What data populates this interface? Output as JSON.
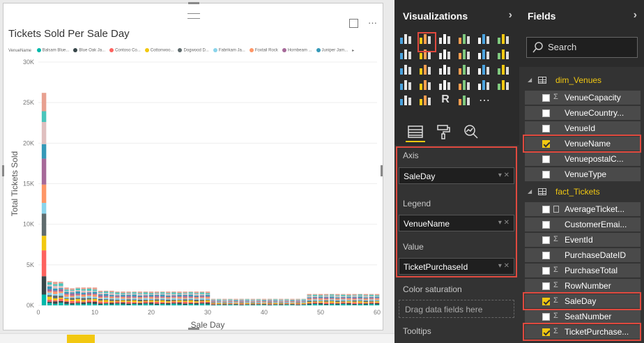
{
  "visual": {
    "title": "Tickets Sold Per Sale Day",
    "legend_title": "VenueName",
    "legend_items": [
      {
        "label": "Balsam Blue...",
        "color": "#01b8aa"
      },
      {
        "label": "Blue Oak Ja...",
        "color": "#374649"
      },
      {
        "label": "Contoso Co...",
        "color": "#fd625e"
      },
      {
        "label": "Cottonwoo...",
        "color": "#f2c80f"
      },
      {
        "label": "Dogwood D...",
        "color": "#5f6b6d"
      },
      {
        "label": "Fabrikam Ja...",
        "color": "#8ad4eb"
      },
      {
        "label": "Foxtail Rock",
        "color": "#fe9666"
      },
      {
        "label": "Hornbeam ...",
        "color": "#a66999"
      },
      {
        "label": "Juniper Jam...",
        "color": "#3599b8"
      }
    ],
    "focus_icon": "expand-icon",
    "more_icon": "ellipsis-icon"
  },
  "chart_data": {
    "type": "bar",
    "stacked": true,
    "xlabel": "Sale Day",
    "ylabel": "Total Tickets Sold",
    "xlim": [
      0,
      60
    ],
    "ylim": [
      0,
      30000
    ],
    "x_ticks": [
      "0",
      "10",
      "20",
      "30",
      "40",
      "50",
      "60"
    ],
    "y_ticks": [
      "0K",
      "5K",
      "10K",
      "15K",
      "20K",
      "25K",
      "30K"
    ],
    "grid": true,
    "legend_position": "top",
    "x": [
      1,
      2,
      3,
      4,
      5,
      6,
      7,
      8,
      9,
      10,
      11,
      12,
      13,
      14,
      15,
      16,
      17,
      18,
      19,
      20,
      21,
      22,
      23,
      24,
      25,
      26,
      27,
      28,
      29,
      30,
      31,
      32,
      33,
      34,
      35,
      36,
      37,
      38,
      39,
      40,
      41,
      42,
      43,
      44,
      45,
      46,
      47,
      48,
      49,
      50,
      51,
      52,
      53,
      54,
      55,
      56,
      57,
      58,
      59,
      60
    ],
    "totals": [
      26200,
      3000,
      2900,
      2900,
      2200,
      2100,
      2200,
      2200,
      2200,
      2200,
      1800,
      1800,
      1800,
      1700,
      1700,
      1700,
      1700,
      1700,
      1700,
      1700,
      1700,
      1700,
      1700,
      1700,
      1700,
      1700,
      1700,
      1700,
      1700,
      1700,
      800,
      800,
      800,
      800,
      800,
      800,
      800,
      800,
      800,
      800,
      800,
      800,
      800,
      800,
      800,
      800,
      800,
      1400,
      1400,
      1400,
      1400,
      1400,
      1400,
      1400,
      1400,
      1400,
      1400,
      1400,
      1400,
      1400
    ],
    "series_colors": [
      "#01b8aa",
      "#374649",
      "#fd625e",
      "#f2c80f",
      "#5f6b6d",
      "#8ad4eb",
      "#fe9666",
      "#a66999",
      "#3599b8",
      "#dfbfbf",
      "#4ac5bb",
      "#e8a090"
    ]
  },
  "viz_pane": {
    "title": "Visualizations",
    "tabs": [
      "fields-tab",
      "format-tab",
      "analytics-tab"
    ],
    "wells": {
      "axis_label": "Axis",
      "axis_value": "SaleDay",
      "legend_label": "Legend",
      "legend_value": "VenueName",
      "value_label": "Value",
      "value_value": "TicketPurchaseId",
      "color_saturation_label": "Color saturation",
      "drop_placeholder": "Drag data fields here",
      "tooltips_label": "Tooltips"
    }
  },
  "fields_pane": {
    "title": "Fields",
    "search_placeholder": "Search",
    "tables": [
      {
        "name": "dim_Venues",
        "fields": [
          {
            "name": "VenueCapacity",
            "sigma": true,
            "checked": false
          },
          {
            "name": "VenueCountry...",
            "sigma": false,
            "checked": false
          },
          {
            "name": "VenueId",
            "sigma": false,
            "checked": false
          },
          {
            "name": "VenueName",
            "sigma": false,
            "checked": true
          },
          {
            "name": "VenuepostalC...",
            "sigma": false,
            "checked": false
          },
          {
            "name": "VenueType",
            "sigma": false,
            "checked": false
          }
        ]
      },
      {
        "name": "fact_Tickets",
        "fields": [
          {
            "name": "AverageTicket...",
            "sigma": false,
            "calc": true,
            "checked": false
          },
          {
            "name": "CustomerEmai...",
            "sigma": false,
            "checked": false
          },
          {
            "name": "EventId",
            "sigma": true,
            "checked": false
          },
          {
            "name": "PurchaseDateID",
            "sigma": false,
            "checked": false
          },
          {
            "name": "PurchaseTotal",
            "sigma": true,
            "checked": false
          },
          {
            "name": "RowNumber",
            "sigma": true,
            "checked": false
          },
          {
            "name": "SaleDay",
            "sigma": true,
            "checked": true
          },
          {
            "name": "SeatNumber",
            "sigma": true,
            "checked": false
          },
          {
            "name": "TicketPurchase...",
            "sigma": true,
            "checked": true
          }
        ]
      }
    ]
  }
}
